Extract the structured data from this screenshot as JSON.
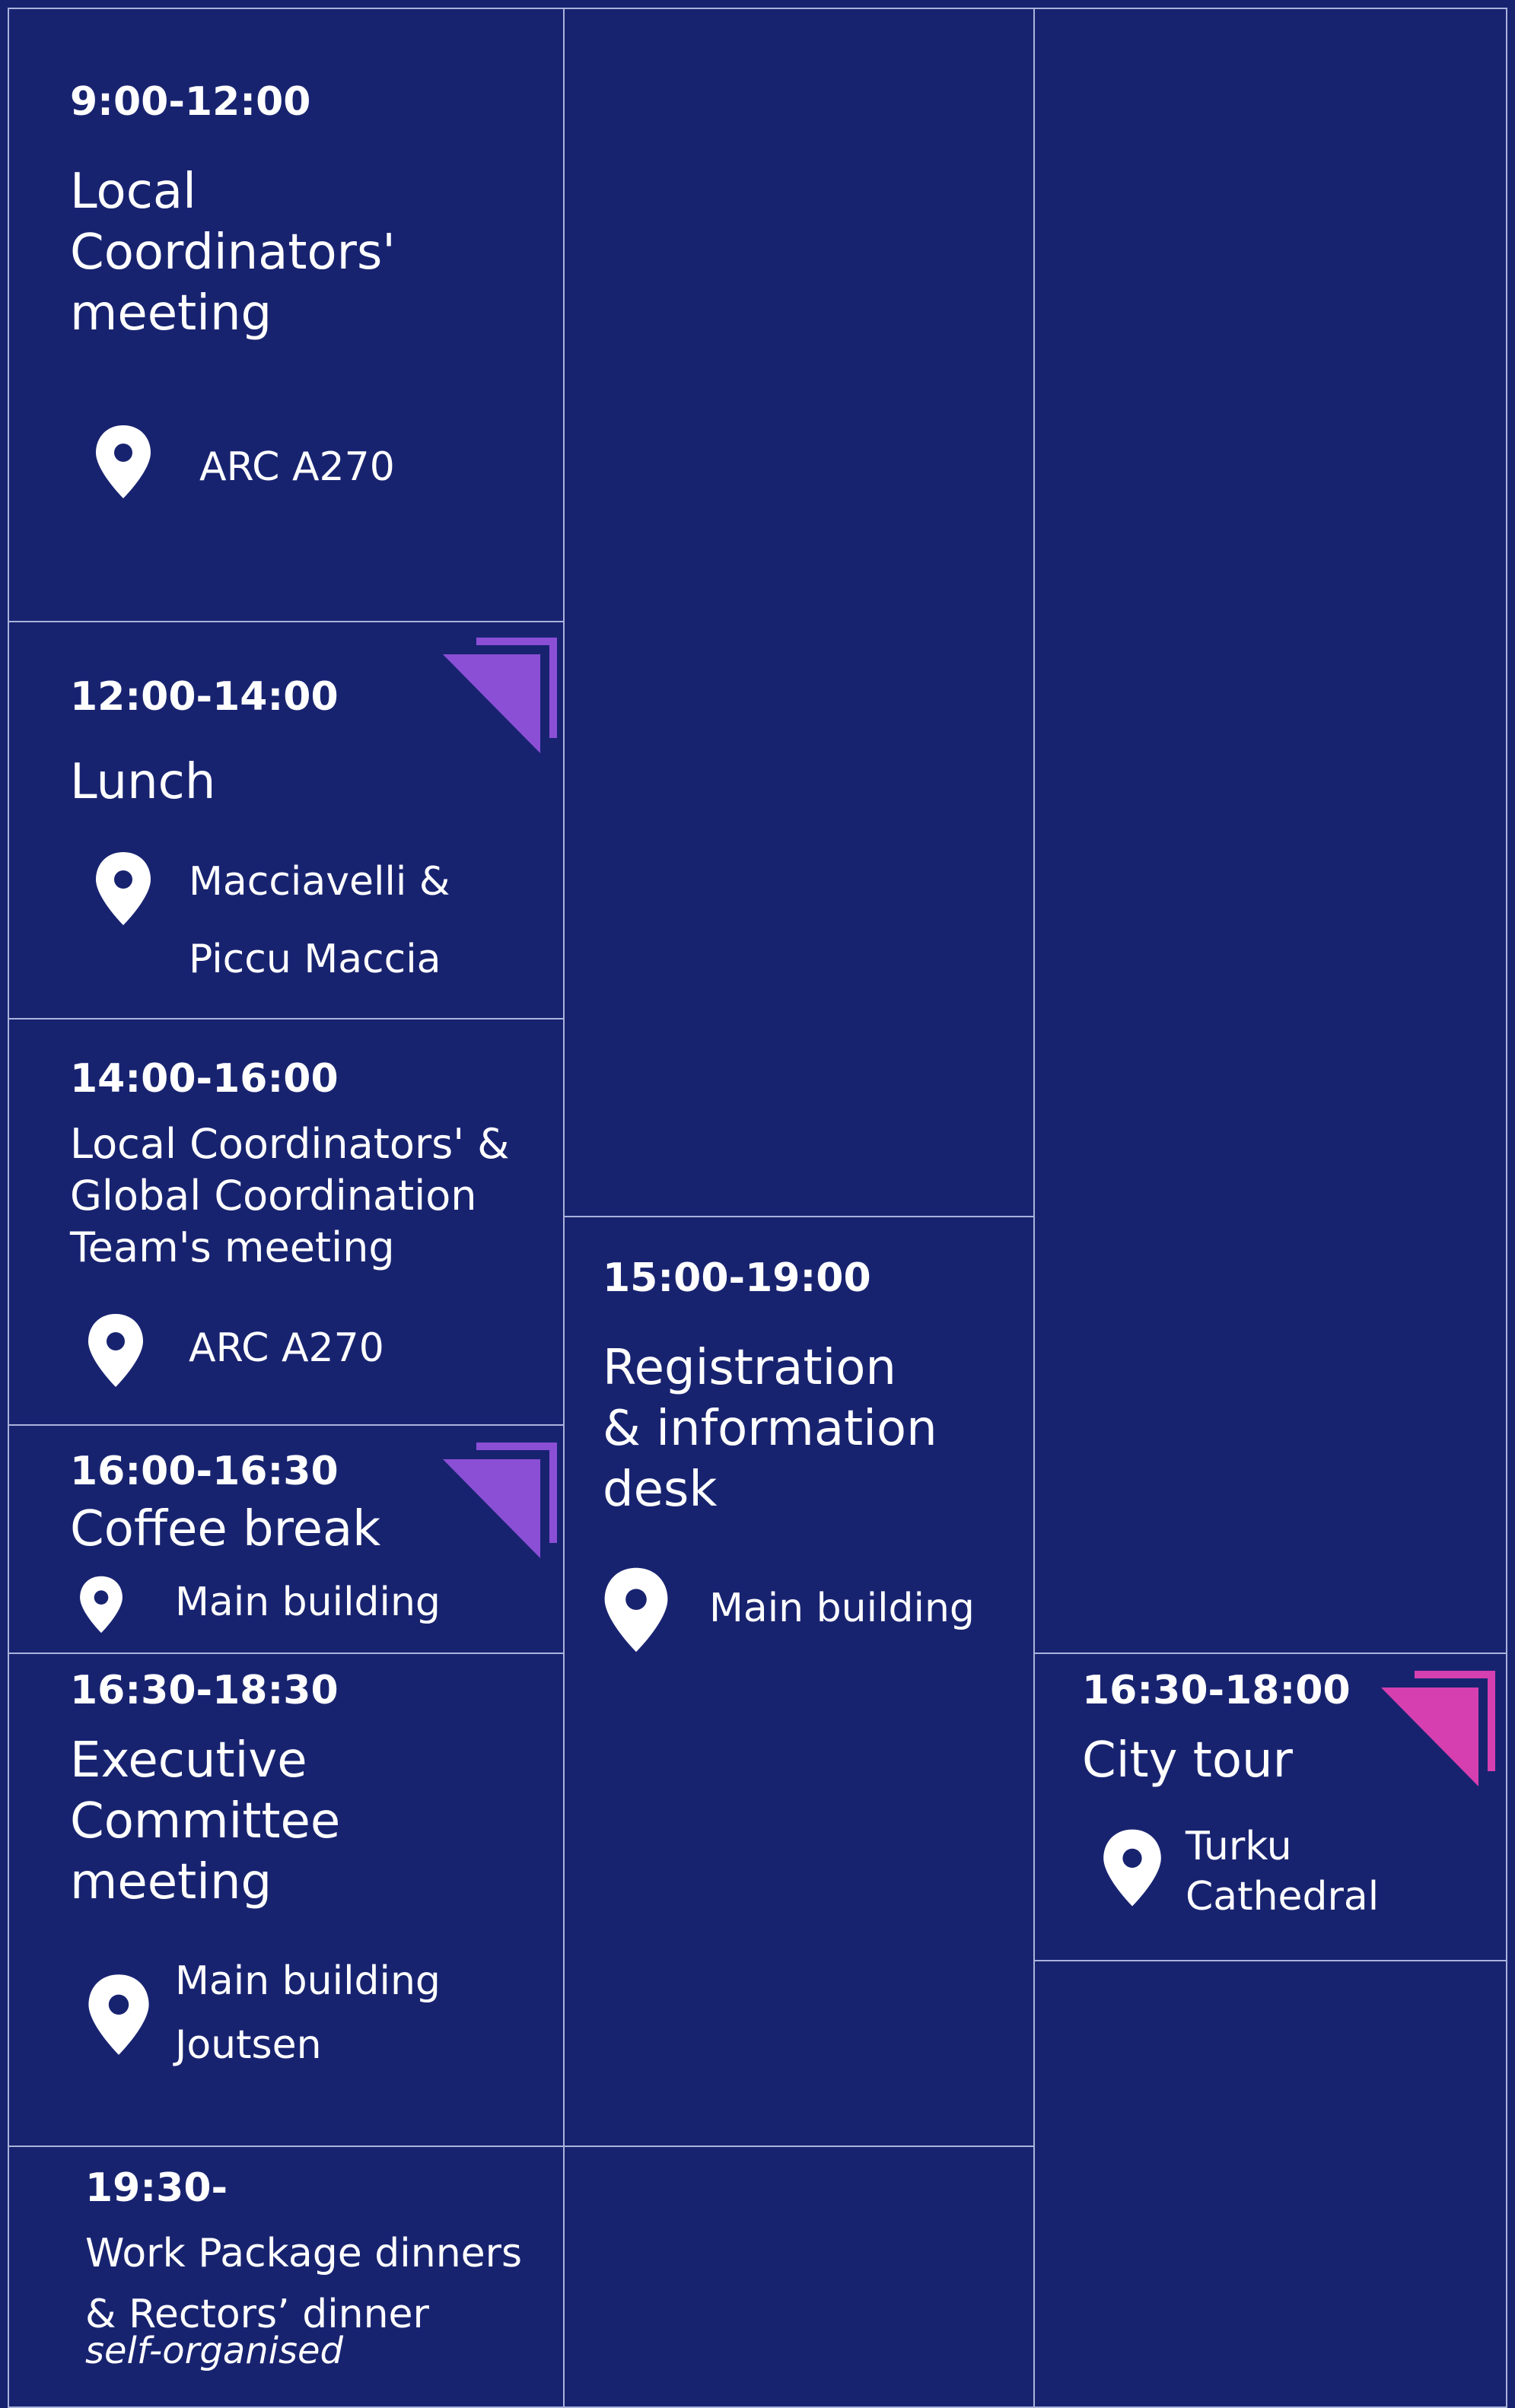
{
  "colors": {
    "background": "#182370",
    "border": "#aab3da",
    "accent_purple": "#8b4fd6",
    "accent_pink": "#d63fb0"
  },
  "icons": {
    "location": "map-pin-icon",
    "corner_decoration": "corner-triangle-icon"
  },
  "column1": {
    "event1": {
      "time": "9:00-12:00",
      "title": "Local\nCoordinators'\nmeeting",
      "location": "ARC A270"
    },
    "event2": {
      "time": "12:00-14:00",
      "title": "Lunch",
      "location": "Macciavelli &\nPiccu Maccia"
    },
    "event3": {
      "time": "14:00-16:00",
      "title": "Local Coordinators' &\nGlobal Coordination\nTeam's meeting",
      "location": "ARC A270"
    },
    "event4": {
      "time": "16:00-16:30",
      "title": "Coffee break",
      "location": "Main building"
    },
    "event5": {
      "time": "16:30-18:30",
      "title": "Executive\nCommittee\nmeeting",
      "location": "Main building\nJoutsen"
    },
    "event6": {
      "time": "19:30-",
      "title": "Work Package dinners\n& Rectors’ dinner",
      "note": "self-organised"
    }
  },
  "column2": {
    "event1": {
      "time": "15:00-19:00",
      "title": "Registration\n& information\ndesk",
      "location": "Main building"
    }
  },
  "column3": {
    "event1": {
      "time": "16:30-18:00",
      "title": "City tour",
      "location": "Turku\nCathedral"
    }
  }
}
